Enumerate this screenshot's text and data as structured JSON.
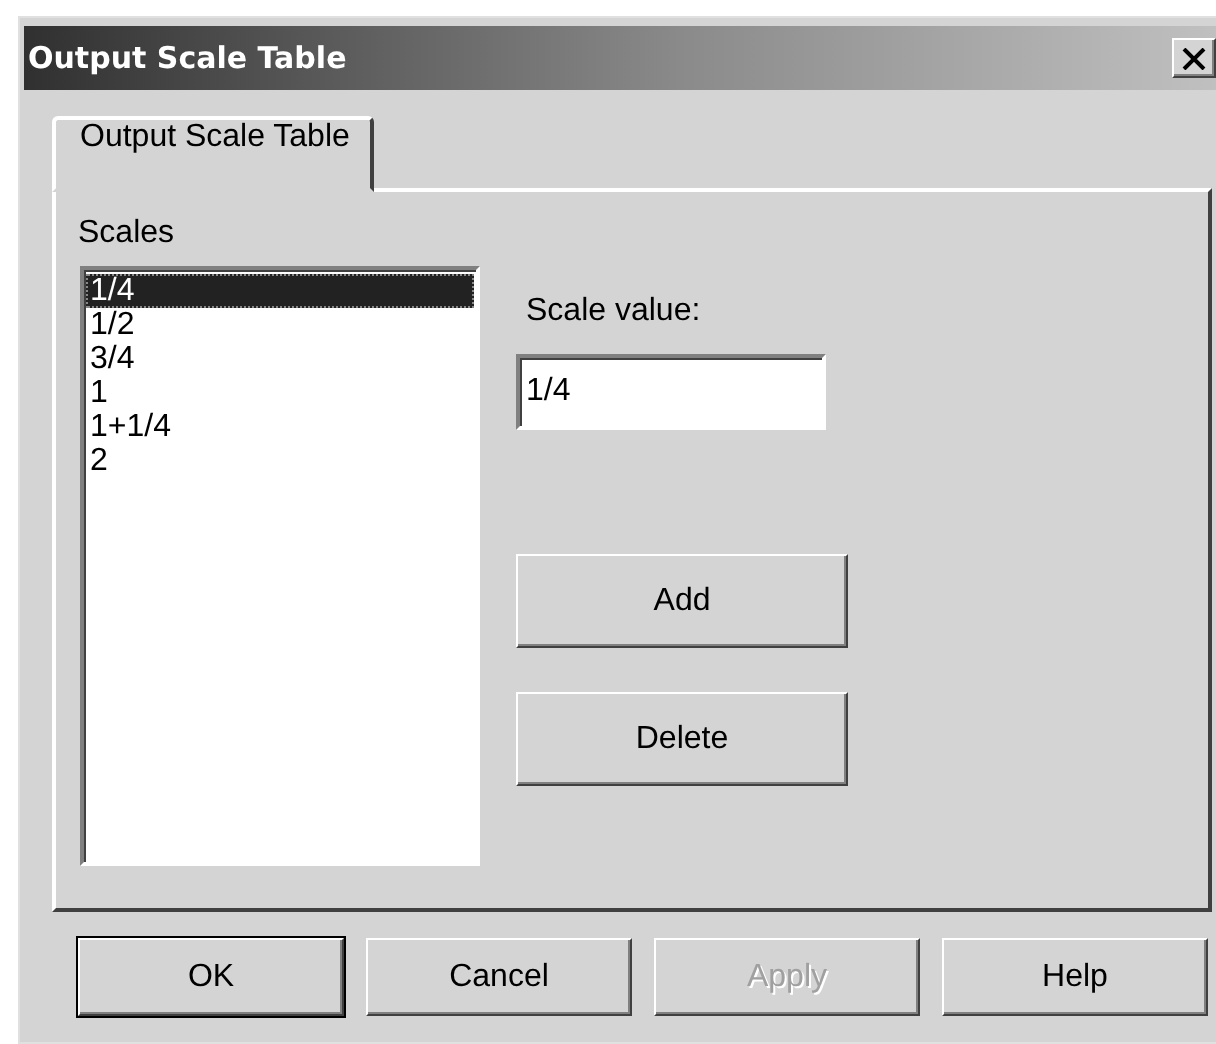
{
  "window": {
    "title": "Output Scale Table"
  },
  "tabs": [
    {
      "label": "Output Scale Table",
      "selected": true
    }
  ],
  "scales": {
    "label": "Scales",
    "items": [
      {
        "text": "1/4",
        "selected": true
      },
      {
        "text": "1/2",
        "selected": false
      },
      {
        "text": "3/4",
        "selected": false
      },
      {
        "text": "1",
        "selected": false
      },
      {
        "text": "1+1/4",
        "selected": false
      },
      {
        "text": "2",
        "selected": false
      }
    ]
  },
  "scale_value": {
    "label": "Scale value:",
    "value": "1/4"
  },
  "side_buttons": [
    {
      "label": "Add",
      "disabled": false
    },
    {
      "label": "Delete",
      "disabled": false
    }
  ],
  "buttons": [
    {
      "label": "OK",
      "default": true,
      "disabled": false
    },
    {
      "label": "Cancel",
      "default": false,
      "disabled": false
    },
    {
      "label": "Apply",
      "default": false,
      "disabled": true
    },
    {
      "label": "Help",
      "default": false,
      "disabled": false
    }
  ]
}
